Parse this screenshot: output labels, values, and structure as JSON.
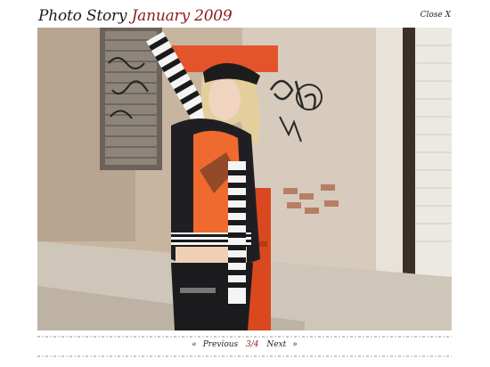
{
  "header": {
    "title_prefix": "Photo Story",
    "title_date": "January 2009",
    "close_label": "Close X"
  },
  "photo": {
    "description_icon": "fashion-photo"
  },
  "nav": {
    "prev_arrow": "«",
    "prev_label": "Previous",
    "page": "3/4",
    "next_label": "Next",
    "next_arrow": "»"
  },
  "colors": {
    "accent": "#8b1a1a",
    "text": "#1a1a1a"
  }
}
